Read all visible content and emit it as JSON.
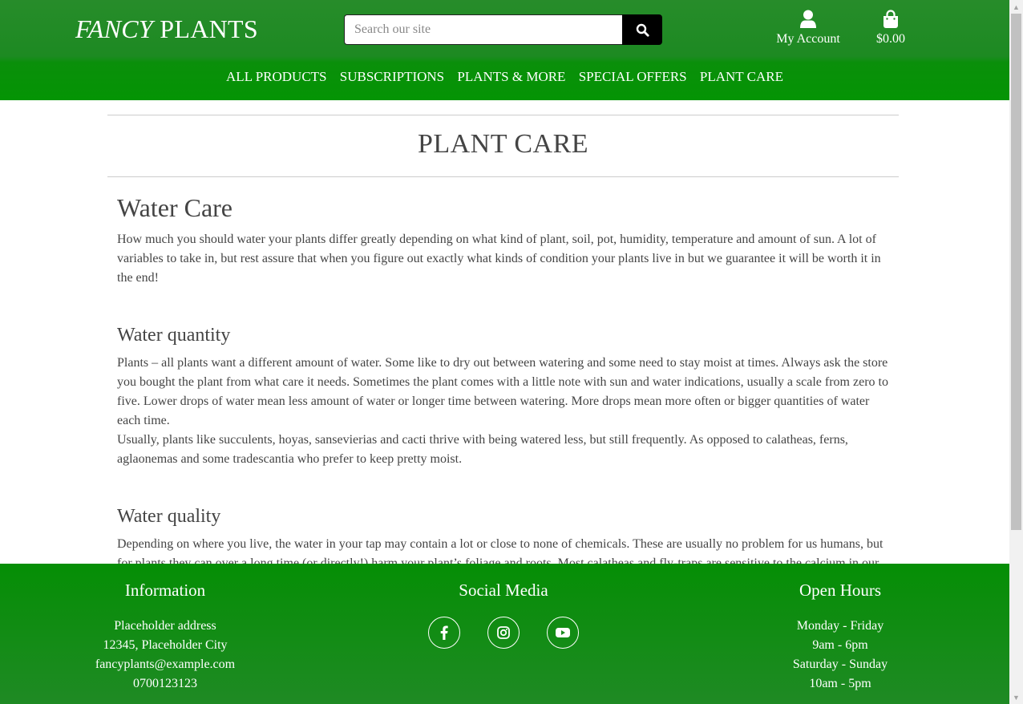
{
  "header": {
    "logo_fancy": "FANCY",
    "logo_plants": "PLANTS",
    "search_placeholder": "Search our site",
    "account_label": "My Account",
    "cart_total": "$0.00"
  },
  "nav": {
    "items": [
      "ALL PRODUCTS",
      "SUBSCRIPTIONS",
      "PLANTS & MORE",
      "SPECIAL OFFERS",
      "PLANT CARE"
    ]
  },
  "page": {
    "title": "PLANT CARE",
    "sections": [
      {
        "heading": "Water Care",
        "paragraphs": [
          "How much you should water your plants differ greatly depending on what kind of plant, soil, pot, humidity, temperature and amount of sun. A lot of variables to take in, but rest assure that when you figure out exactly what kinds of condition your plants live in but we guarantee it will be worth it in the end!"
        ]
      },
      {
        "heading": "Water quantity",
        "paragraphs": [
          "Plants – all plants want a different amount of water. Some like to dry out between watering and some need to stay moist at times. Always ask the store you bought the plant from what care it needs. Sometimes the plant comes with a little note with sun and water indications, usually a scale from zero to five. Lower drops of water mean less amount of water or longer time between watering. More drops mean more often or bigger quantities of water each time.",
          "Usually, plants like succulents, hoyas, sansevierias and cacti thrive with being watered less, but still frequently. As opposed to calatheas, ferns, aglaonemas and some tradescantia who prefer to keep pretty moist."
        ]
      },
      {
        "heading": "Water quality",
        "paragraphs": [
          "Depending on where you live, the water in your tap may contain a lot or close to none of chemicals. These are usually no problem for us humans, but for plants they can over a long time (or directly!) harm your plant’s foliage and roots. Most calatheas and fly-traps are sensitive to the calcium in our"
        ]
      }
    ]
  },
  "footer": {
    "info_heading": "Information",
    "info_lines": [
      "Placeholder address",
      "12345, Placeholder City",
      "fancyplants@example.com",
      "0700123123"
    ],
    "social_heading": "Social Media",
    "social_icons": [
      "facebook-icon",
      "instagram-icon",
      "youtube-icon"
    ],
    "hours_heading": "Open Hours",
    "hours_lines": [
      "Monday - Friday",
      "9am - 6pm",
      "Saturday - Sunday",
      "10am - 5pm"
    ]
  },
  "colors": {
    "header_green": "#278c2a",
    "nav_green": "#049404",
    "footer_green": "#058e05",
    "text": "#444444"
  }
}
